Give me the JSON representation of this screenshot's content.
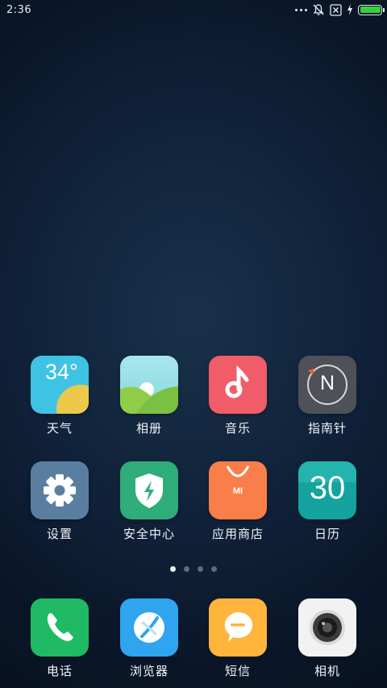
{
  "status_bar": {
    "time": "2:36",
    "battery_level": 1.0,
    "battery_color": "#38d13c",
    "icons": [
      "more-dots-icon",
      "bell-muted-icon",
      "no-sim-icon",
      "charging-icon",
      "battery-icon"
    ]
  },
  "apps": [
    {
      "name": "weather",
      "label": "天气",
      "icon_text": "34°",
      "color": "#3ec3e5"
    },
    {
      "name": "gallery",
      "label": "相册",
      "color": "#7ed3c4"
    },
    {
      "name": "music",
      "label": "音乐",
      "color": "#f05c68"
    },
    {
      "name": "compass",
      "label": "指南针",
      "icon_text": "N",
      "color": "#4e5158"
    },
    {
      "name": "settings",
      "label": "设置",
      "color": "#5a7ea0"
    },
    {
      "name": "security",
      "label": "安全中心",
      "color": "#2eac7a"
    },
    {
      "name": "app-store",
      "label": "应用商店",
      "icon_text": "MI",
      "color": "#f97e4a"
    },
    {
      "name": "calendar",
      "label": "日历",
      "icon_text": "30",
      "color": "#14a39e"
    }
  ],
  "dock": [
    {
      "name": "phone",
      "label": "电话",
      "color": "#1fba63"
    },
    {
      "name": "browser",
      "label": "浏览器",
      "color": "#2fa4ef"
    },
    {
      "name": "messages",
      "label": "短信",
      "color": "#ffb43c"
    },
    {
      "name": "camera",
      "label": "相机",
      "color": "#f2f2f2"
    }
  ],
  "page_indicator": {
    "count": 4,
    "active_index": 0
  }
}
